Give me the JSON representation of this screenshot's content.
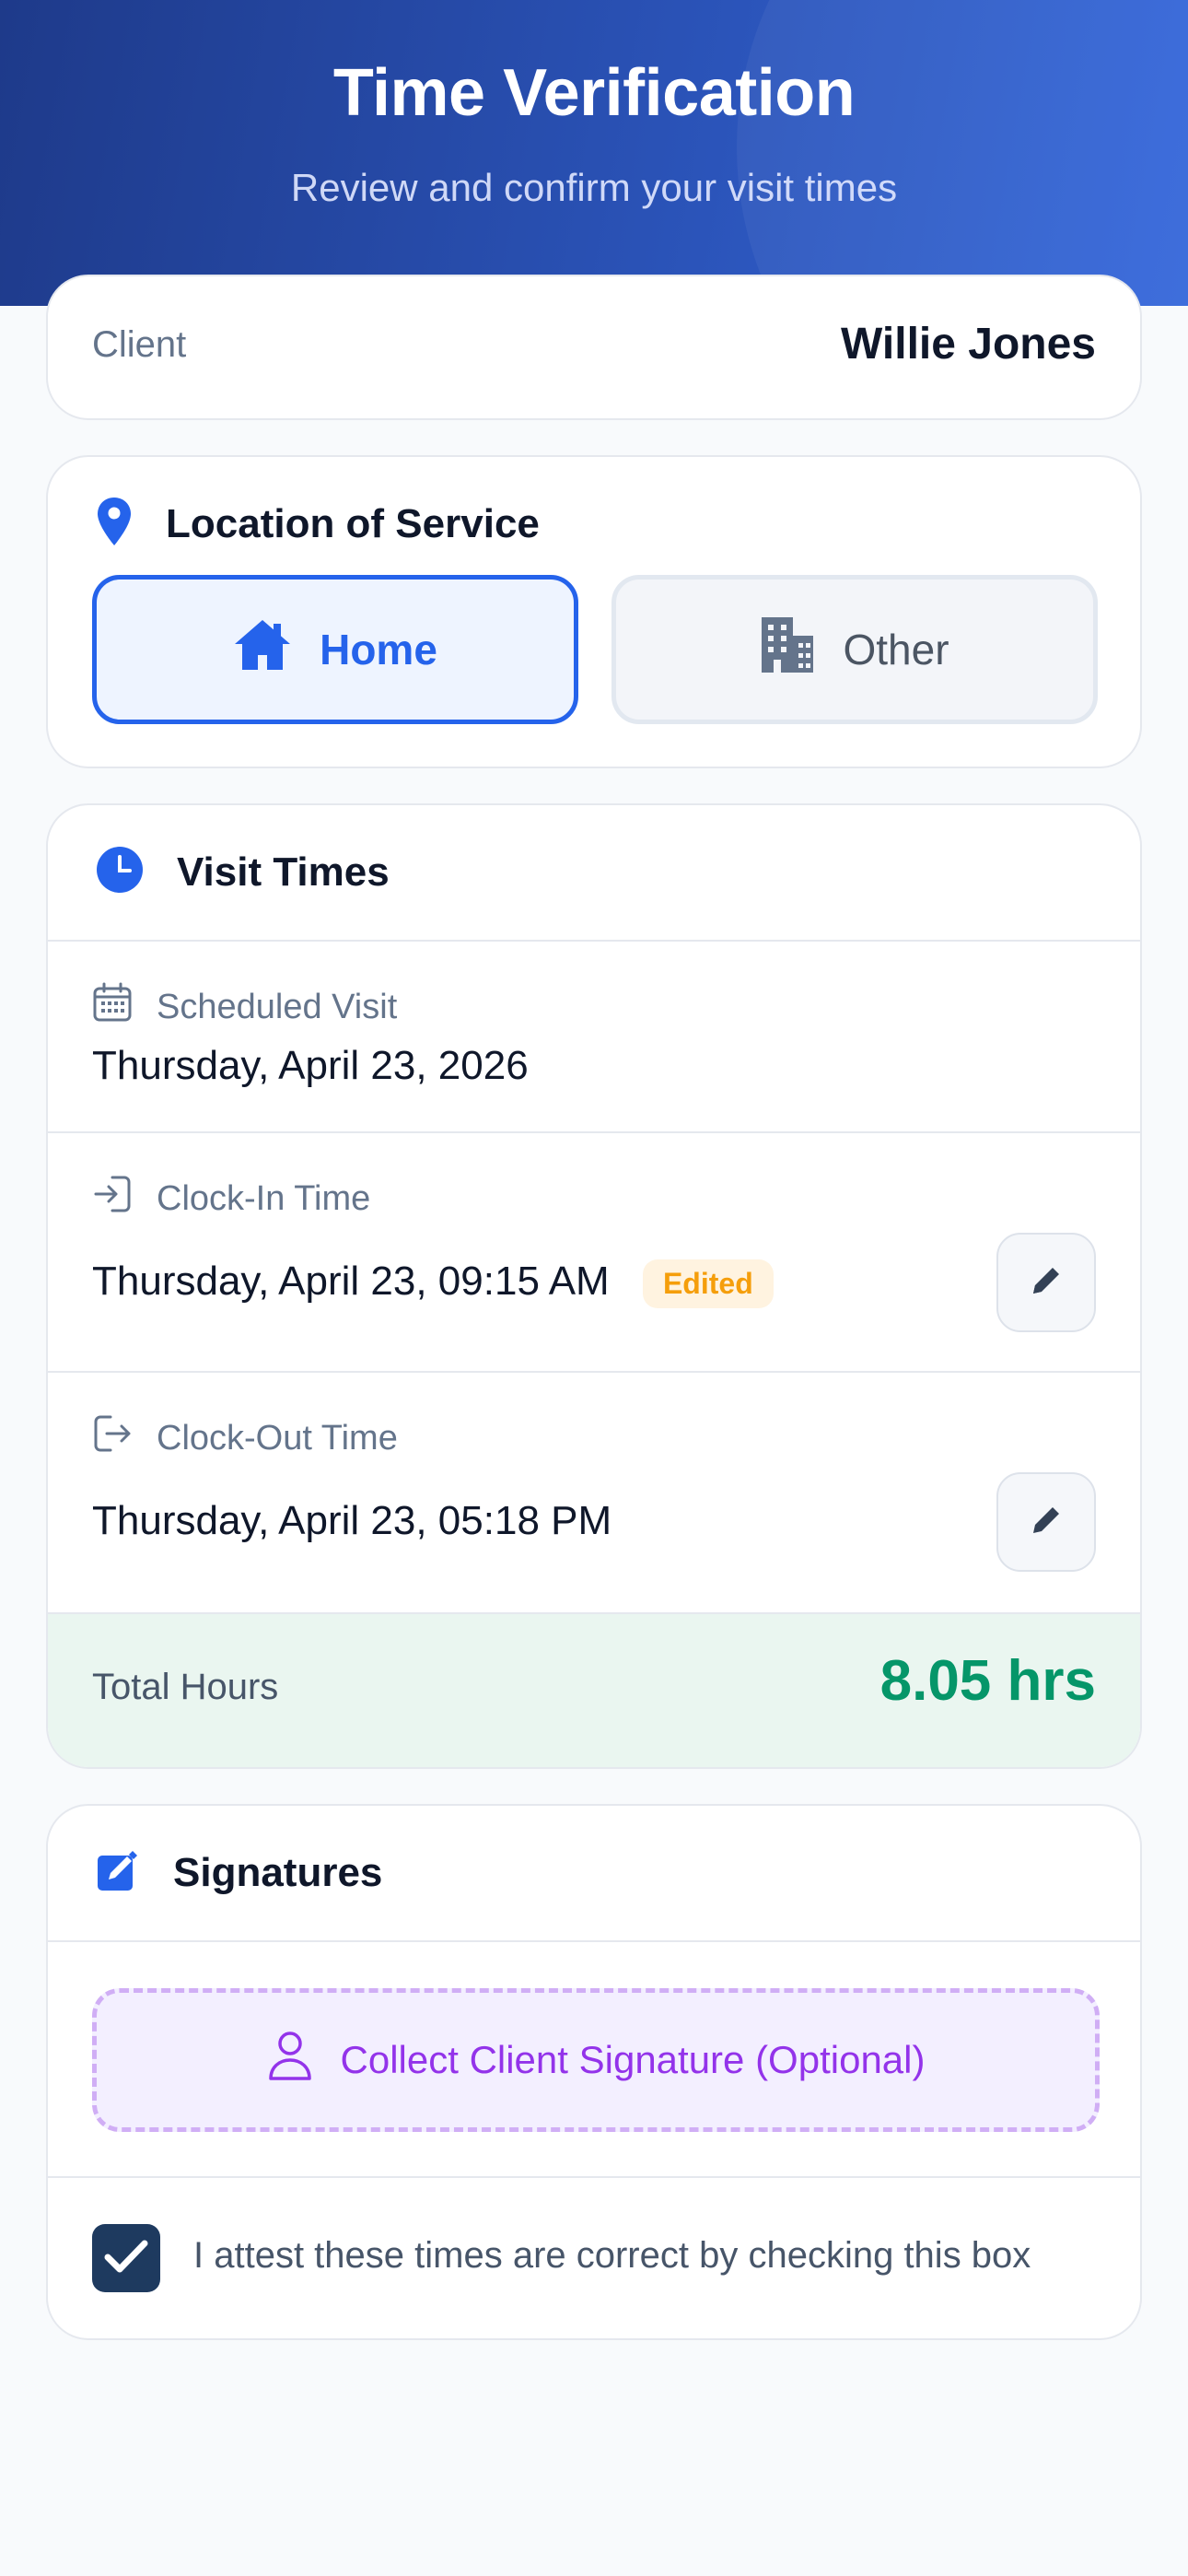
{
  "header": {
    "title": "Time Verification",
    "subtitle": "Review and confirm your visit times"
  },
  "client": {
    "label": "Client",
    "name": "Willie Jones"
  },
  "location": {
    "title": "Location of Service",
    "icon": "map-pin-icon",
    "options": [
      {
        "label": "Home",
        "icon": "home-icon",
        "selected": true
      },
      {
        "label": "Other",
        "icon": "building-icon",
        "selected": false
      }
    ]
  },
  "visit_times": {
    "title": "Visit Times",
    "icon": "clock-icon",
    "scheduled": {
      "label": "Scheduled Visit",
      "value": "Thursday, April 23, 2026",
      "icon": "calendar-icon"
    },
    "clock_in": {
      "label": "Clock-In Time",
      "value": "Thursday, April 23, 09:15 AM",
      "badge": "Edited",
      "icon": "login-icon"
    },
    "clock_out": {
      "label": "Clock-Out Time",
      "value": "Thursday, April 23, 05:18 PM",
      "icon": "logout-icon"
    },
    "total": {
      "label": "Total Hours",
      "value": "8.05 hrs"
    }
  },
  "signatures": {
    "title": "Signatures",
    "icon": "edit-square-icon",
    "collect_label": "Collect Client Signature (Optional)",
    "attest_label": "I attest these times are correct by checking this box",
    "attest_checked": true
  },
  "colors": {
    "primary": "#2563eb",
    "header_dark": "#1e3a8a",
    "total_green": "#059669",
    "badge_orange": "#f59e0b",
    "signature_purple": "#9333ea",
    "checkbox_navy": "#1e3a5f"
  }
}
